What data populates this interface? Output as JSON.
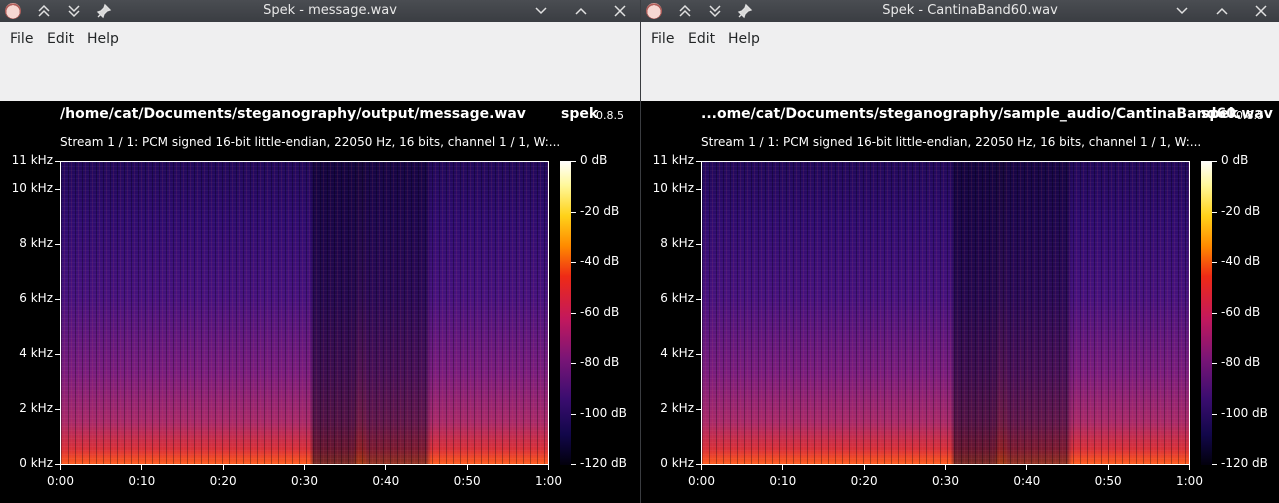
{
  "windows": [
    {
      "title": "Spek - message.wav",
      "menu": [
        "File",
        "Edit",
        "Help"
      ],
      "file_path": "/home/cat/Documents/steganography/output/message.wav",
      "app_name": "spek",
      "version": "0.8.5",
      "stream_info": "Stream 1 / 1: PCM signed 16-bit little-endian, 22050 Hz, 16 bits, channel 1 / 1, W:...",
      "freq_ticks": [
        "11 kHz",
        "10 kHz",
        "8 kHz",
        "6 kHz",
        "4 kHz",
        "2 kHz",
        "0 kHz"
      ],
      "time_ticks": [
        "0:00",
        "0:10",
        "0:20",
        "0:30",
        "0:40",
        "0:50",
        "1:00"
      ],
      "db_ticks": [
        "0 dB",
        "-20 dB",
        "-40 dB",
        "-60 dB",
        "-80 dB",
        "-100 dB",
        "-120 dB"
      ]
    },
    {
      "title": "Spek - CantinaBand60.wav",
      "menu": [
        "File",
        "Edit",
        "Help"
      ],
      "file_path": "...ome/cat/Documents/steganography/sample_audio/CantinaBand60.wav",
      "app_name": "spek",
      "version": "0.8.5",
      "stream_info": "Stream 1 / 1: PCM signed 16-bit little-endian, 22050 Hz, 16 bits, channel 1 / 1, W:...",
      "freq_ticks": [
        "11 kHz",
        "10 kHz",
        "8 kHz",
        "6 kHz",
        "4 kHz",
        "2 kHz",
        "0 kHz"
      ],
      "time_ticks": [
        "0:00",
        "0:10",
        "0:20",
        "0:30",
        "0:40",
        "0:50",
        "1:00"
      ],
      "db_ticks": [
        "0 dB",
        "-20 dB",
        "-40 dB",
        "-60 dB",
        "-80 dB",
        "-100 dB",
        "-120 dB"
      ]
    }
  ],
  "spectrogram": {
    "freq_max_khz": 11,
    "freq_tick_values_khz": [
      11,
      10,
      8,
      6,
      4,
      2,
      0
    ],
    "duration_s": 60,
    "time_tick_values_s": [
      0,
      10,
      20,
      30,
      40,
      50,
      60
    ],
    "db_range": [
      -120,
      0
    ],
    "db_tick_values": [
      0,
      -20,
      -40,
      -60,
      -80,
      -100,
      -120
    ]
  },
  "icons": {
    "app": "spek-app-icon",
    "keep_above": "chevron-double-up-icon",
    "keep_below": "chevron-double-down-icon",
    "pin": "pin-icon",
    "minimize": "chevron-down-icon",
    "maximize": "chevron-up-icon",
    "close": "close-icon"
  }
}
